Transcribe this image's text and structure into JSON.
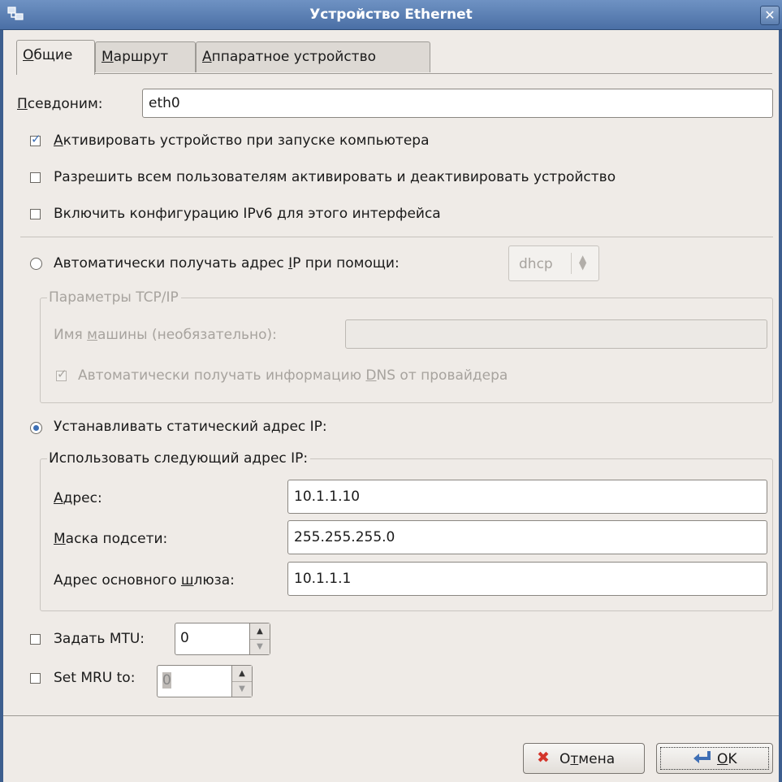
{
  "window": {
    "title": "Устройство Ethernet"
  },
  "tabs": [
    {
      "label": "Общие",
      "access_key": "О",
      "rest": "бщие"
    },
    {
      "label": "Маршрут",
      "access_key": "М",
      "rest": "аршрут"
    },
    {
      "label": "Аппаратное устройство",
      "access_key": "А",
      "rest": "ппаратное устройство"
    }
  ],
  "alias": {
    "access_key": "П",
    "rest": "севдоним:",
    "value": "eth0"
  },
  "options": {
    "activate_on_boot": {
      "access_key": "А",
      "rest": "ктивировать устройство при запуске компьютера",
      "checked": true
    },
    "allow_users": {
      "label": "Разрешить всем пользователям активировать и деактивировать устройство",
      "checked": false
    },
    "enable_ipv6": {
      "label": "Включить конфигурацию IPv6 для этого интерфейса",
      "checked": false
    }
  },
  "auto_ip": {
    "label_before": "Автоматически получать адрес ",
    "access_key": "I",
    "label_after": "P при помощи:",
    "selected": false,
    "method": "dhcp"
  },
  "tcpip": {
    "legend": "Параметры TCP/IP",
    "hostname_before": "Имя ",
    "hostname_key": "м",
    "hostname_after": "ашины (необязательно):",
    "hostname_value": "",
    "dns_before": "Автоматически получать информацию ",
    "dns_key": "D",
    "dns_after": "NS от провайдера",
    "dns_checked": true
  },
  "static_ip": {
    "label": "Устанавливать статический адрес IP:",
    "selected": true,
    "legend": "Использовать следующий адрес IP:",
    "address": {
      "access_key": "А",
      "rest": "дрес:",
      "value": "10.1.1.10"
    },
    "netmask": {
      "access_key": "М",
      "rest": "аска подсети:",
      "value": "255.255.255.0"
    },
    "gateway": {
      "before": "Адрес основного ",
      "access_key": "ш",
      "rest": "люза:",
      "value": "10.1.1.1"
    }
  },
  "mtu": {
    "label": "Задать MTU:",
    "value": "0",
    "checked": false
  },
  "mru": {
    "label": "Set MRU to:",
    "value": "0",
    "checked": false
  },
  "buttons": {
    "cancel_before": "О",
    "cancel_key": "т",
    "cancel_rest": "мена",
    "ok_key": "O",
    "ok_rest": "K"
  },
  "icons": {
    "window": "network-icon",
    "cancel": "cross-icon",
    "ok": "enter-arrow-icon"
  },
  "colors": {
    "titlebar": "#4a6fa5",
    "check_accent": "#3d6fb5",
    "cancel_cross": "#d4352a"
  }
}
